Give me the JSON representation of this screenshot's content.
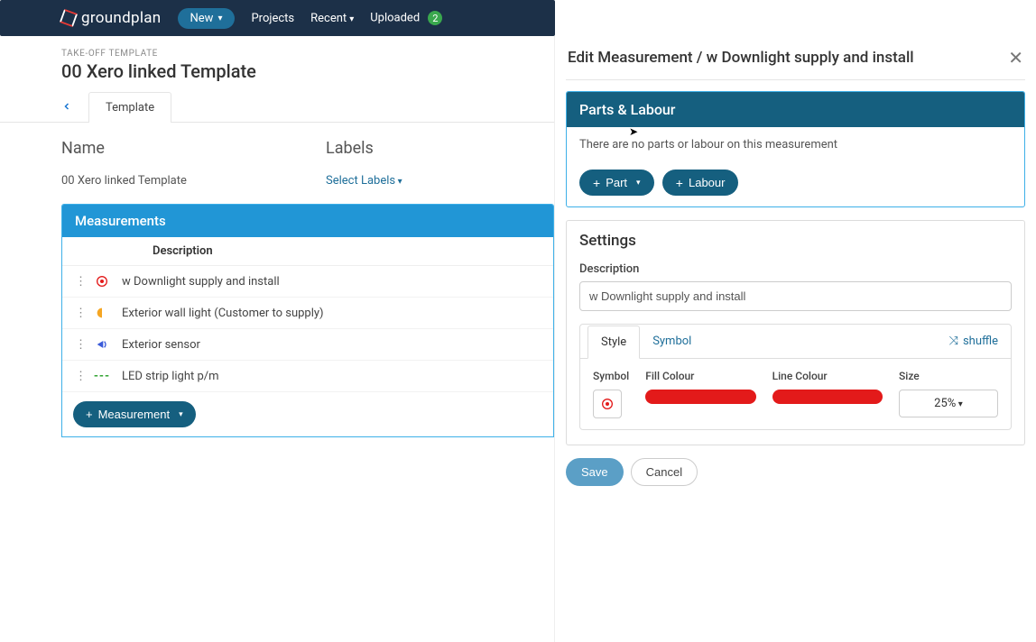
{
  "navbar": {
    "brand": "groundplan",
    "new_label": "New",
    "projects_label": "Projects",
    "recent_label": "Recent",
    "uploaded_label": "Uploaded",
    "uploaded_badge": "2"
  },
  "breadcrumb": {
    "small": "TAKE-OFF TEMPLATE",
    "title": "00 Xero linked Template"
  },
  "tabs": {
    "template_label": "Template"
  },
  "form": {
    "name_label": "Name",
    "name_value": "00 Xero linked Template",
    "labels_label": "Labels",
    "labels_select": "Select Labels"
  },
  "measurements": {
    "header": "Measurements",
    "col_description": "Description",
    "rows": [
      {
        "desc": "w Downlight supply and install"
      },
      {
        "desc": "Exterior wall light (Customer to supply)"
      },
      {
        "desc": "Exterior sensor"
      },
      {
        "desc": "LED strip light p/m"
      }
    ],
    "add_button": "Measurement"
  },
  "panel": {
    "title": "Edit Measurement / w Downlight supply and install",
    "parts": {
      "header": "Parts & Labour",
      "empty": "There are no parts or labour on this measurement",
      "part_btn": "Part",
      "labour_btn": "Labour"
    },
    "settings": {
      "title": "Settings",
      "description_label": "Description",
      "description_value": "w Downlight supply and install",
      "style_tab": "Style",
      "symbol_tab": "Symbol",
      "shuffle": "shuffle",
      "symbol_label": "Symbol",
      "fill_label": "Fill Colour",
      "line_label": "Line Colour",
      "size_label": "Size",
      "size_value": "25%",
      "fill_colour": "#e31a1a",
      "line_colour": "#e31a1a"
    },
    "save_btn": "Save",
    "cancel_btn": "Cancel"
  }
}
